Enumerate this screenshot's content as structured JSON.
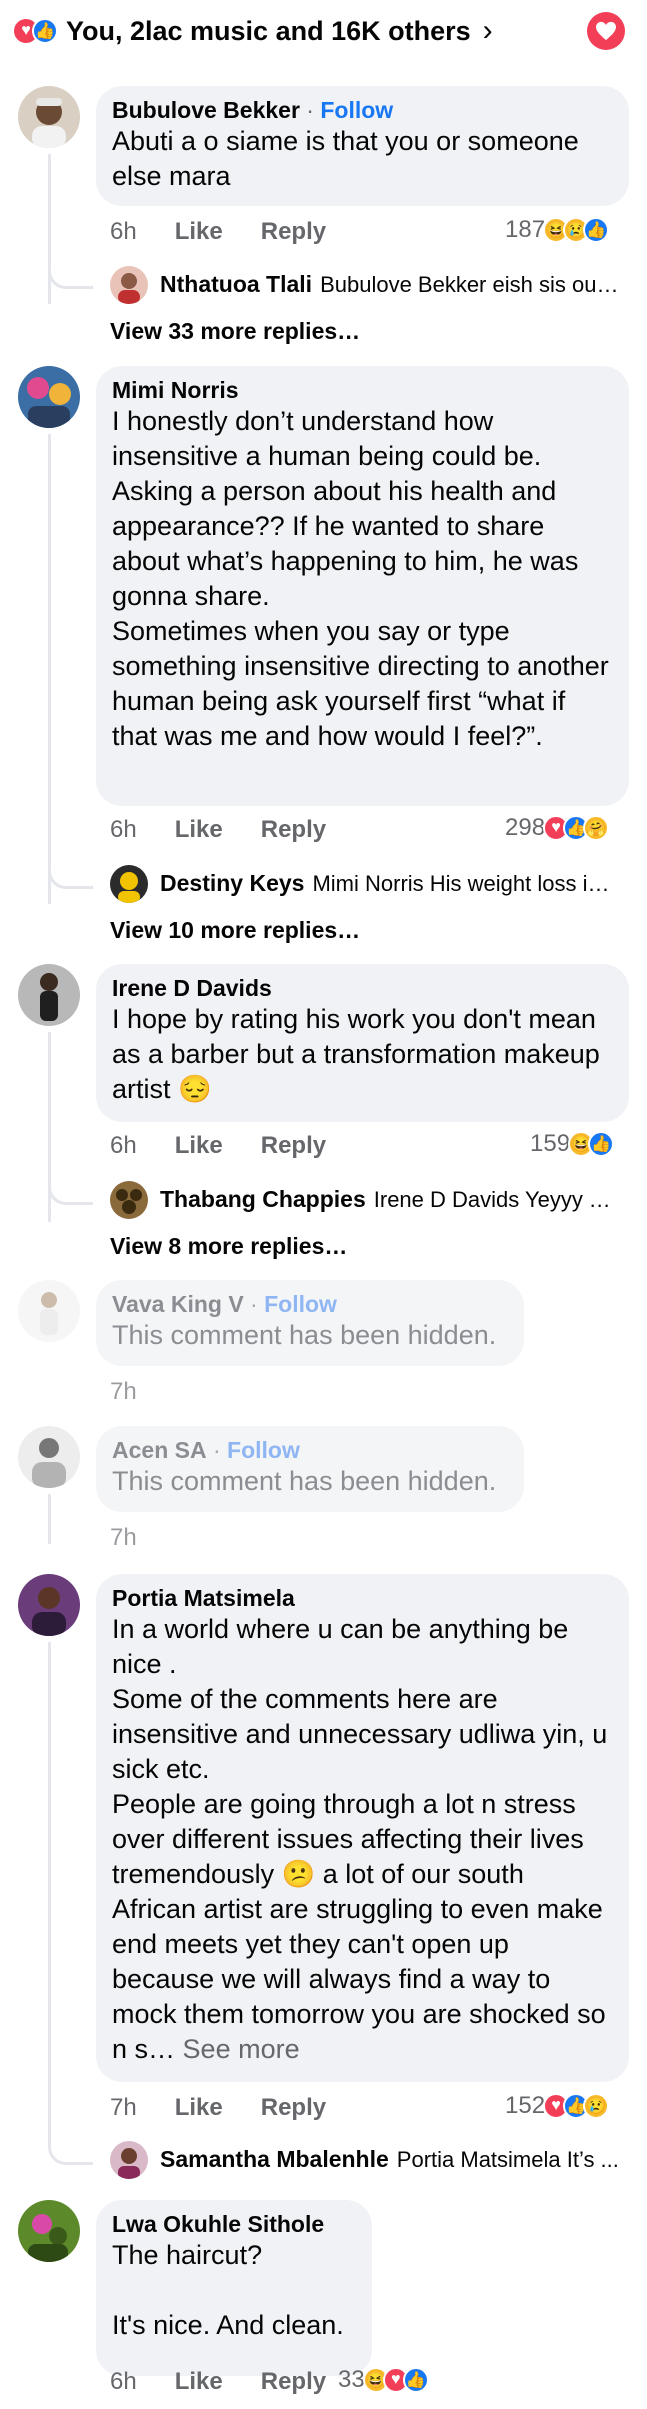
{
  "header": {
    "summary": "You, 2lac music and 16K others",
    "colors": {
      "love": "#f33e58",
      "like": "#1877f2"
    }
  },
  "comments": [
    {
      "name": "Bubulove Bekker",
      "follow": "Follow",
      "text": "Abuti a o siame is that you or someone else mara",
      "time": "6h",
      "like": "Like",
      "reply": "Reply",
      "count": "187",
      "reactions": [
        "haha-icon",
        "sad-icon",
        "like-icon"
      ],
      "preview_reply": {
        "name": "Nthatuoa Tlali",
        "text": "Bubulove Bekker eish sis our..."
      },
      "view_more": "View 33 more replies…"
    },
    {
      "name": "Mimi Norris",
      "text": "I honestly don’t understand how insensitive a human being could be. Asking a person about his health and appearance?? If he wanted to share about what’s happening to him, he was gonna share.\nSometimes when you say or type something insensitive directing to another human being ask yourself first “what if that was me and how would I feel?”.",
      "time": "6h",
      "like": "Like",
      "reply": "Reply",
      "count": "298",
      "reactions": [
        "love-icon",
        "like-icon",
        "care-icon"
      ],
      "preview_reply": {
        "name": "Destiny Keys",
        "text": "Mimi Norris His weight loss is ..."
      },
      "view_more": "View 10 more replies…"
    },
    {
      "name": "Irene D Davids",
      "text": "I hope by rating his work you don't mean as a barber but a transformation makeup artist 😔",
      "time": "6h",
      "like": "Like",
      "reply": "Reply",
      "count": "159",
      "reactions": [
        "haha-icon",
        "like-icon"
      ],
      "preview_reply": {
        "name": "Thabang Chappies",
        "text": "Irene D Davids Yeyyy Th..."
      },
      "view_more": "View 8 more replies…"
    },
    {
      "name": "Vava King V",
      "follow": "Follow",
      "text": "This comment has been hidden.",
      "time": "7h"
    },
    {
      "name": "Acen SA",
      "follow": "Follow",
      "text": "This comment has been hidden.",
      "time": "7h"
    },
    {
      "name": "Portia Matsimela",
      "text": "In a world where u can be anything be nice .\nSome of the comments here are insensitive and unnecessary udliwa yin, u sick etc.\nPeople are going through a lot n stress over different issues affecting their lives tremendously 😕 a lot of our south African artist are struggling to even make end meets yet they can't open up because we will always find a way to mock them tomorrow you are shocked so n s…",
      "see_more": "See more",
      "time": "7h",
      "like": "Like",
      "reply": "Reply",
      "count": "152",
      "reactions": [
        "love-icon",
        "like-icon",
        "sad-icon"
      ],
      "preview_reply": {
        "name": "Samantha Mbalenhle",
        "text": "Portia Matsimela It’s ..."
      }
    },
    {
      "name": "Lwa Okuhle Sithole",
      "text": "The haircut?\n\nIt's nice. And clean.",
      "time": "6h",
      "like": "Like",
      "reply": "Reply",
      "count": "33",
      "reactions": [
        "haha-icon",
        "love-icon",
        "like-icon"
      ]
    }
  ]
}
